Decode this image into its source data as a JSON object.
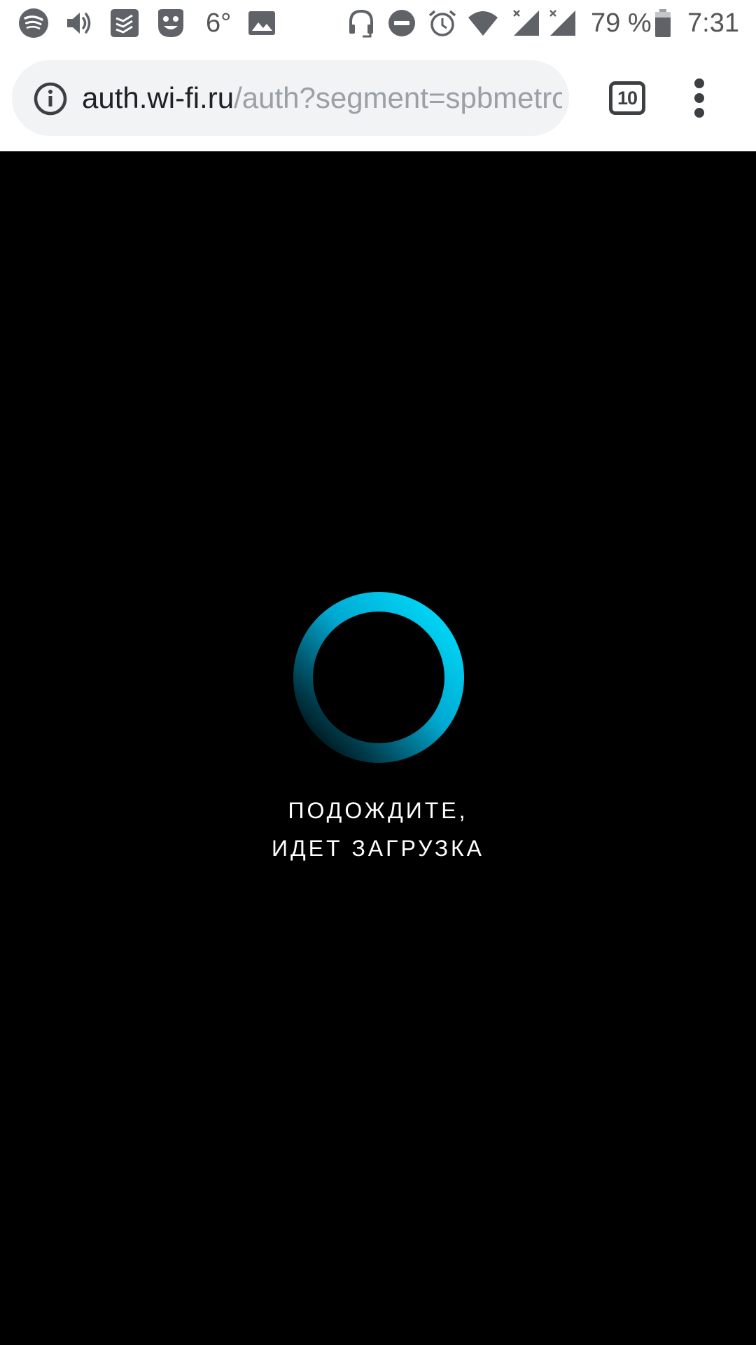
{
  "status_bar": {
    "icons_left": [
      "spotify-icon",
      "volume-icon",
      "todoist-icon",
      "app-face-icon"
    ],
    "temperature": "6°",
    "icons_right": [
      "headset-icon",
      "do-not-disturb-icon",
      "alarm-icon",
      "wifi-icon",
      "signal-icon",
      "signal-icon"
    ],
    "battery_percent": "79 %",
    "time": "7:31"
  },
  "browser": {
    "url_host": "auth.wi-fi.ru",
    "url_path": "/auth?segment=spbmetro",
    "tab_count": "10",
    "menu_icon": "more-vert-icon",
    "info_icon": "info-icon"
  },
  "page": {
    "loading_line1": "ПОДОЖДИТЕ,",
    "loading_line2": "ИДЕТ ЗАГРУЗКА",
    "spinner_color": "#00d2ff"
  }
}
